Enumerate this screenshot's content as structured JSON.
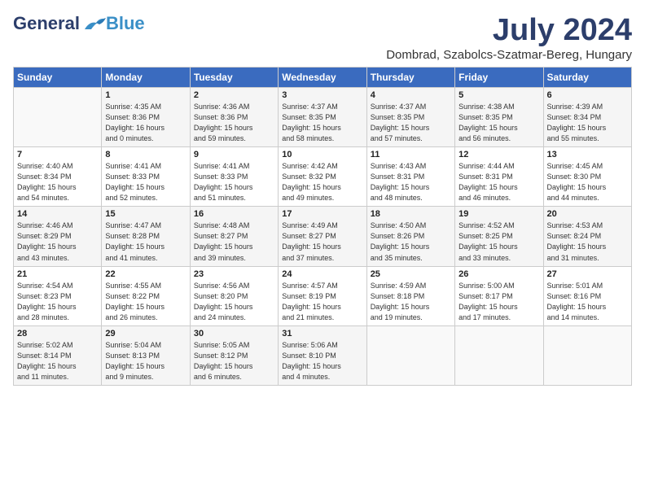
{
  "header": {
    "logo_general": "General",
    "logo_blue": "Blue",
    "month_title": "July 2024",
    "subtitle": "Dombrad, Szabolcs-Szatmar-Bereg, Hungary"
  },
  "weekdays": [
    "Sunday",
    "Monday",
    "Tuesday",
    "Wednesday",
    "Thursday",
    "Friday",
    "Saturday"
  ],
  "weeks": [
    [
      {
        "day": "",
        "info": ""
      },
      {
        "day": "1",
        "info": "Sunrise: 4:35 AM\nSunset: 8:36 PM\nDaylight: 16 hours\nand 0 minutes."
      },
      {
        "day": "2",
        "info": "Sunrise: 4:36 AM\nSunset: 8:36 PM\nDaylight: 15 hours\nand 59 minutes."
      },
      {
        "day": "3",
        "info": "Sunrise: 4:37 AM\nSunset: 8:35 PM\nDaylight: 15 hours\nand 58 minutes."
      },
      {
        "day": "4",
        "info": "Sunrise: 4:37 AM\nSunset: 8:35 PM\nDaylight: 15 hours\nand 57 minutes."
      },
      {
        "day": "5",
        "info": "Sunrise: 4:38 AM\nSunset: 8:35 PM\nDaylight: 15 hours\nand 56 minutes."
      },
      {
        "day": "6",
        "info": "Sunrise: 4:39 AM\nSunset: 8:34 PM\nDaylight: 15 hours\nand 55 minutes."
      }
    ],
    [
      {
        "day": "7",
        "info": "Sunrise: 4:40 AM\nSunset: 8:34 PM\nDaylight: 15 hours\nand 54 minutes."
      },
      {
        "day": "8",
        "info": "Sunrise: 4:41 AM\nSunset: 8:33 PM\nDaylight: 15 hours\nand 52 minutes."
      },
      {
        "day": "9",
        "info": "Sunrise: 4:41 AM\nSunset: 8:33 PM\nDaylight: 15 hours\nand 51 minutes."
      },
      {
        "day": "10",
        "info": "Sunrise: 4:42 AM\nSunset: 8:32 PM\nDaylight: 15 hours\nand 49 minutes."
      },
      {
        "day": "11",
        "info": "Sunrise: 4:43 AM\nSunset: 8:31 PM\nDaylight: 15 hours\nand 48 minutes."
      },
      {
        "day": "12",
        "info": "Sunrise: 4:44 AM\nSunset: 8:31 PM\nDaylight: 15 hours\nand 46 minutes."
      },
      {
        "day": "13",
        "info": "Sunrise: 4:45 AM\nSunset: 8:30 PM\nDaylight: 15 hours\nand 44 minutes."
      }
    ],
    [
      {
        "day": "14",
        "info": "Sunrise: 4:46 AM\nSunset: 8:29 PM\nDaylight: 15 hours\nand 43 minutes."
      },
      {
        "day": "15",
        "info": "Sunrise: 4:47 AM\nSunset: 8:28 PM\nDaylight: 15 hours\nand 41 minutes."
      },
      {
        "day": "16",
        "info": "Sunrise: 4:48 AM\nSunset: 8:27 PM\nDaylight: 15 hours\nand 39 minutes."
      },
      {
        "day": "17",
        "info": "Sunrise: 4:49 AM\nSunset: 8:27 PM\nDaylight: 15 hours\nand 37 minutes."
      },
      {
        "day": "18",
        "info": "Sunrise: 4:50 AM\nSunset: 8:26 PM\nDaylight: 15 hours\nand 35 minutes."
      },
      {
        "day": "19",
        "info": "Sunrise: 4:52 AM\nSunset: 8:25 PM\nDaylight: 15 hours\nand 33 minutes."
      },
      {
        "day": "20",
        "info": "Sunrise: 4:53 AM\nSunset: 8:24 PM\nDaylight: 15 hours\nand 31 minutes."
      }
    ],
    [
      {
        "day": "21",
        "info": "Sunrise: 4:54 AM\nSunset: 8:23 PM\nDaylight: 15 hours\nand 28 minutes."
      },
      {
        "day": "22",
        "info": "Sunrise: 4:55 AM\nSunset: 8:22 PM\nDaylight: 15 hours\nand 26 minutes."
      },
      {
        "day": "23",
        "info": "Sunrise: 4:56 AM\nSunset: 8:20 PM\nDaylight: 15 hours\nand 24 minutes."
      },
      {
        "day": "24",
        "info": "Sunrise: 4:57 AM\nSunset: 8:19 PM\nDaylight: 15 hours\nand 21 minutes."
      },
      {
        "day": "25",
        "info": "Sunrise: 4:59 AM\nSunset: 8:18 PM\nDaylight: 15 hours\nand 19 minutes."
      },
      {
        "day": "26",
        "info": "Sunrise: 5:00 AM\nSunset: 8:17 PM\nDaylight: 15 hours\nand 17 minutes."
      },
      {
        "day": "27",
        "info": "Sunrise: 5:01 AM\nSunset: 8:16 PM\nDaylight: 15 hours\nand 14 minutes."
      }
    ],
    [
      {
        "day": "28",
        "info": "Sunrise: 5:02 AM\nSunset: 8:14 PM\nDaylight: 15 hours\nand 11 minutes."
      },
      {
        "day": "29",
        "info": "Sunrise: 5:04 AM\nSunset: 8:13 PM\nDaylight: 15 hours\nand 9 minutes."
      },
      {
        "day": "30",
        "info": "Sunrise: 5:05 AM\nSunset: 8:12 PM\nDaylight: 15 hours\nand 6 minutes."
      },
      {
        "day": "31",
        "info": "Sunrise: 5:06 AM\nSunset: 8:10 PM\nDaylight: 15 hours\nand 4 minutes."
      },
      {
        "day": "",
        "info": ""
      },
      {
        "day": "",
        "info": ""
      },
      {
        "day": "",
        "info": ""
      }
    ]
  ]
}
